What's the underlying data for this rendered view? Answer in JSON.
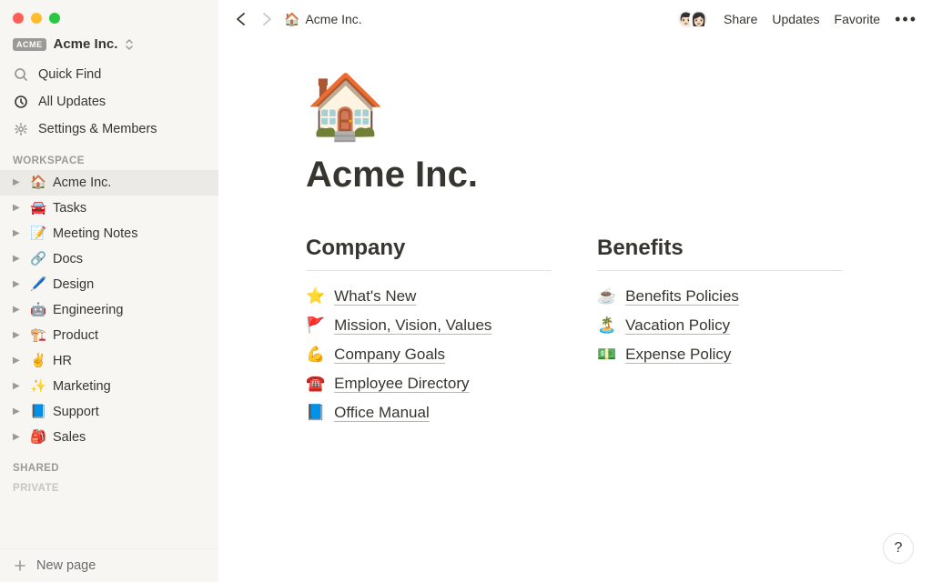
{
  "workspace": {
    "badge": "ACME",
    "name": "Acme Inc."
  },
  "sidebar_nav": {
    "quick_find": "Quick Find",
    "all_updates": "All Updates",
    "settings": "Settings & Members"
  },
  "sidebar_sections": {
    "workspace_label": "WORKSPACE",
    "shared_label": "SHARED",
    "private_label": "PRIVATE"
  },
  "workspace_pages": [
    {
      "emoji": "🏠",
      "label": "Acme Inc.",
      "active": true
    },
    {
      "emoji": "🚘",
      "label": "Tasks"
    },
    {
      "emoji": "📝",
      "label": "Meeting Notes"
    },
    {
      "emoji": "🔗",
      "label": "Docs"
    },
    {
      "emoji": "🖊️",
      "label": "Design"
    },
    {
      "emoji": "🤖",
      "label": "Engineering"
    },
    {
      "emoji": "🏗️",
      "label": "Product"
    },
    {
      "emoji": "✌️",
      "label": "HR"
    },
    {
      "emoji": "✨",
      "label": "Marketing"
    },
    {
      "emoji": "📘",
      "label": "Support"
    },
    {
      "emoji": "🎒",
      "label": "Sales"
    }
  ],
  "new_page_label": "New page",
  "breadcrumb": {
    "emoji": "🏠",
    "label": "Acme Inc."
  },
  "topbar_actions": {
    "share": "Share",
    "updates": "Updates",
    "favorite": "Favorite"
  },
  "page": {
    "emoji": "🏠",
    "title": "Acme Inc."
  },
  "columns": [
    {
      "heading": "Company",
      "links": [
        {
          "emoji": "⭐",
          "label": "What's New"
        },
        {
          "emoji": "🚩",
          "label": "Mission, Vision, Values"
        },
        {
          "emoji": "💪",
          "label": "Company Goals"
        },
        {
          "emoji": "☎️",
          "label": "Employee Directory"
        },
        {
          "emoji": "📘",
          "label": "Office Manual"
        }
      ]
    },
    {
      "heading": "Benefits",
      "links": [
        {
          "emoji": "☕",
          "label": "Benefits Policies"
        },
        {
          "emoji": "🏝️",
          "label": "Vacation Policy"
        },
        {
          "emoji": "💵",
          "label": "Expense Policy"
        }
      ]
    }
  ],
  "help_label": "?"
}
